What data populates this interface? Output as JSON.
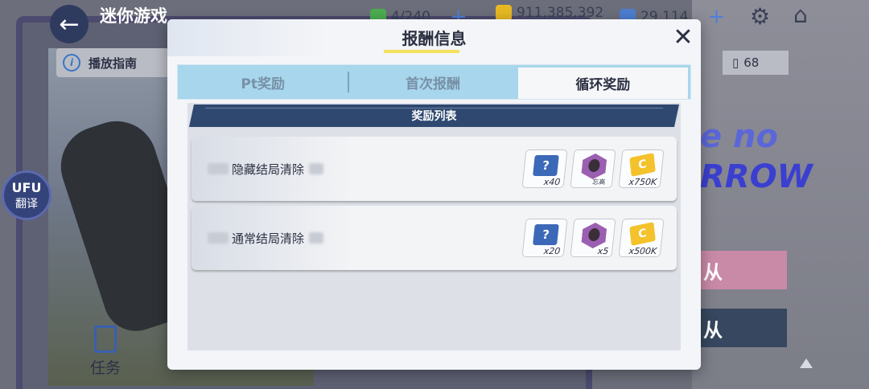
{
  "topbar": {
    "title": "迷你游戏",
    "stamina": "4/240",
    "coins": "911,385,392",
    "gems": "29,114"
  },
  "guide_label": "播放指南",
  "ticket_count": "68",
  "translate_label": "翻译",
  "translate_glyph": "UFU",
  "task_label": "任务",
  "side_card_1": "从",
  "side_card_2": "从",
  "background_logo": [
    "e no",
    "RROW"
  ],
  "modal": {
    "title": "报酬信息",
    "tabs": [
      {
        "label": "Pt奖励",
        "active": false
      },
      {
        "label": "首次报酬",
        "active": false
      },
      {
        "label": "循环奖励",
        "active": true
      }
    ],
    "list_header": "奖励列表",
    "rows": [
      {
        "label": "隐藏结局清除",
        "rewards": [
          {
            "icon": "treasure-box-icon",
            "qty": "x40"
          },
          {
            "icon": "character-hex-icon",
            "qty": "",
            "rank": "忘高"
          },
          {
            "icon": "coin-card-icon",
            "qty": "x750K"
          }
        ]
      },
      {
        "label": "通常结局清除",
        "rewards": [
          {
            "icon": "treasure-box-icon",
            "qty": "x20"
          },
          {
            "icon": "character-hex-icon",
            "qty": "x5",
            "rank": ""
          },
          {
            "icon": "coin-card-icon",
            "qty": "x500K"
          }
        ]
      }
    ]
  },
  "colors": {
    "accent_underline": "#f4e15c",
    "tab_bar": "#a8d6ec",
    "list_header_bg": "#2e4870"
  }
}
